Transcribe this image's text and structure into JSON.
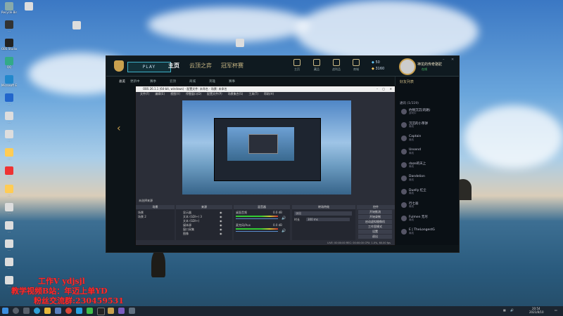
{
  "desktop": {
    "icons": [
      {
        "label": "Recycle Bin",
        "color": "#8aa"
      },
      {
        "label": "...",
        "color": "#333"
      },
      {
        "label": "OBS Studio",
        "color": "#222"
      },
      {
        "label": "QQ",
        "color": "#3a8"
      },
      {
        "label": "Microsoft Edge",
        "color": "#28c"
      },
      {
        "label": "...",
        "color": "#26c"
      },
      {
        "label": "...",
        "color": "#ddd"
      },
      {
        "label": "...",
        "color": "#ddd"
      },
      {
        "label": "...",
        "color": "#fc5"
      },
      {
        "label": "...",
        "color": "#e33"
      },
      {
        "label": "...",
        "color": "#fc5"
      },
      {
        "label": "...",
        "color": "#ddd"
      },
      {
        "label": "...",
        "color": "#ddd"
      },
      {
        "label": "...",
        "color": "#ddd"
      },
      {
        "label": "...",
        "color": "#ddd"
      },
      {
        "label": "...",
        "color": "#ddd"
      }
    ]
  },
  "lol": {
    "play": "PLAY",
    "tabs": [
      "主页",
      "云顶之弈",
      "冠军杯赛"
    ],
    "header_buttons": [
      "主页",
      "藏品",
      "战利品",
      "商城"
    ],
    "be": "50",
    "rp": "3160",
    "username": "神龙的传奇骆驼",
    "user_status": "在线",
    "subnav": [
      "总览",
      "更新中",
      "赛季",
      "云顶",
      "商城",
      "英雄",
      "赛事"
    ],
    "friends_title": "好友列表",
    "friends_group": "通讯 (1/119)",
    "friends": [
      {
        "name": "约顿沉沉(的路)",
        "status": "游戏中"
      },
      {
        "name": "沉沉的小茶饼",
        "status": "离线"
      },
      {
        "name": "Captain",
        "status": "离线"
      },
      {
        "name": "Unsend",
        "status": "离线"
      },
      {
        "name": "daze的天上",
        "status": "离线"
      },
      {
        "name": "Dandelion",
        "status": "离线"
      },
      {
        "name": "Duelly 红尘",
        "status": "离线"
      },
      {
        "name": "行七翁",
        "status": "离线"
      },
      {
        "name": "Fulmen 无尽",
        "status": "离线"
      },
      {
        "name": "E | TheLongestG",
        "status": "离线"
      }
    ]
  },
  "obs": {
    "title": "OBS 26.1.1 (64-bit, windows) - 配置文件: 未命名 - 场景: 未命名",
    "menu": [
      "文件(F)",
      "编辑(E)",
      "视图(V)",
      "停靠窗口(D)",
      "配置文件(P)",
      "场景集合(S)",
      "工具(T)",
      "帮助(H)"
    ],
    "docks": [
      "场景",
      "来源",
      "混音器",
      "转场特效",
      "控件"
    ],
    "scenes": [
      "场景",
      "场景 2"
    ],
    "sources": [
      "显示器",
      "文本 (GDI+) 3",
      "文本 (GDI+)",
      "媒体源",
      "窗口采集",
      "图像"
    ],
    "mixer": [
      {
        "name": "桌面音频",
        "db": "0.0 dB"
      },
      {
        "name": "麦克风/Aux",
        "db": "0.0 dB"
      }
    ],
    "transition": {
      "name": "淡出",
      "duration_label": "时长",
      "duration": "300 ms"
    },
    "controls": [
      "开始推流",
      "开始录制",
      "启动虚拟摄像机",
      "工作室模式",
      "设置",
      "退出"
    ],
    "status": "LIVE: 00:00:00   REC: 00:00:00   CPU: 1.0%, 60.00 fps",
    "no_source": "未选择来源"
  },
  "taskbar": {
    "time": "20:54",
    "date": "2021/8/10"
  },
  "watermark": {
    "line1": "工作V ydjsjl",
    "line2": "教学视频B站：年迈上单YD",
    "line3": "粉丝交流群:230459531"
  }
}
